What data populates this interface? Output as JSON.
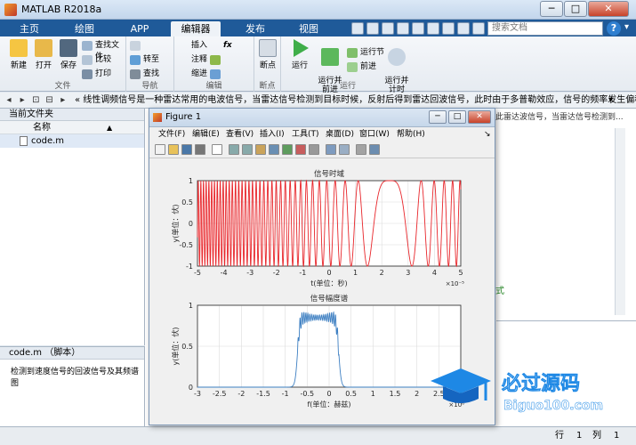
{
  "window": {
    "title": "MATLAB R2018a",
    "min": "─",
    "max": "□",
    "close": "✕"
  },
  "tabs": [
    "主页",
    "绘图",
    "APP",
    "编辑器",
    "发布",
    "视图"
  ],
  "active_tab": "编辑器",
  "search": {
    "placeholder": "搜索文档"
  },
  "ribbon": {
    "file": {
      "label": "文件",
      "new": "新建",
      "open": "打开",
      "save": "保存",
      "find_file": "查找文件",
      "compare": "比较",
      "print": "打印"
    },
    "nav": {
      "label": "导航",
      "goto": "转至",
      "find": "查找"
    },
    "edit": {
      "label": "编辑",
      "insert": "插入",
      "comment": "注释",
      "indent": "缩进",
      "fx": "fx"
    },
    "breakpoint": {
      "label": "断点",
      "breakpoints": "断点"
    },
    "run": {
      "label": "运行",
      "run": "运行",
      "run_advance": "运行并\n前进",
      "run_section": "运行节",
      "advance": "前进",
      "run_time": "运行并\n计时"
    }
  },
  "address_bar": {
    "nav_symbols": [
      "◂",
      "▸",
      "⊡",
      "⊟",
      "▸"
    ],
    "path": "«  线性调频信号是一种雷达常用的电波信号，当雷达信号检测到目标时候，反射后得到雷达回波信号，此时由于多普勒效应，信号的频率发生偏移，这个源...",
    "dropdown": "▾"
  },
  "left_panel": {
    "title": "当前文件夹",
    "name_col": "名称",
    "sort": "▲",
    "files": [
      "code.m"
    ]
  },
  "detail_panel": {
    "title": "code.m （脚本）",
    "description": "检测到速度信号的回波信号及其频谱图"
  },
  "editor_behind": {
    "snippet": "此雷达波信号，当雷达信号检测到...",
    "expr_text": "达式"
  },
  "status_bar": {
    "row_label": "行",
    "row": "1",
    "col_label": "列",
    "col": "1"
  },
  "figure": {
    "title": "Figure 1",
    "menus": [
      "文件(F)",
      "编辑(E)",
      "查看(V)",
      "插入(I)",
      "工具(T)",
      "桌面(D)",
      "窗口(W)",
      "帮助(H)"
    ],
    "menu_arrow": "↘",
    "toolbar_icons": [
      "new-figure-icon",
      "open-icon",
      "save-icon",
      "print-icon",
      "pointer-icon",
      "zoom-in-icon",
      "zoom-out-icon",
      "pan-icon",
      "rotate-icon",
      "datatip-icon",
      "brush-icon",
      "link-icon",
      "colorbar-icon",
      "legend-icon",
      "hide-plot-tools-icon",
      "show-plot-tools-icon"
    ]
  },
  "chart_data": [
    {
      "type": "line",
      "title": "信号时域",
      "xlabel": "t(单位：秒)",
      "ylabel": "y(单位：伏)",
      "xlim": [
        -5,
        5
      ],
      "ylim": [
        -1,
        1
      ],
      "x_ticks": [
        "-5",
        "-4",
        "-3",
        "-2",
        "-1",
        "0",
        "1",
        "2",
        "3",
        "4",
        "5"
      ],
      "y_ticks": [
        "-1",
        "-0.5",
        "0",
        "0.5",
        "1"
      ],
      "x_exponent": "×10⁻⁵",
      "grid": true,
      "color": "#e8262b",
      "description_of_signal": "",
      "vertex_t": 2.3,
      "chirp_k": 0.7
    },
    {
      "type": "line",
      "title": "信号幅度谱",
      "xlabel": "f(单位：赫兹)",
      "ylabel": "y(单位：伏)",
      "xlim": [
        -3,
        3
      ],
      "ylim": [
        0,
        1
      ],
      "x_ticks": [
        "-3",
        "-2.5",
        "-2",
        "-1.5",
        "-1",
        "-0.5",
        "0",
        "0.5",
        "1",
        "1.5",
        "2",
        "2.5",
        "3"
      ],
      "y_ticks": [
        "0",
        "0.5",
        "1"
      ],
      "x_exponent": "×10⁶",
      "grid": true,
      "color": "#3d7fc2",
      "band": [
        -0.72,
        0.22
      ],
      "peak_level": 0.85
    }
  ],
  "watermark": {
    "brand": "必过源码",
    "url": "Biguo100.com"
  },
  "colors": {
    "ribbon_blue": "#1f5a99",
    "signal_red": "#e8262b",
    "spectrum_blue": "#3d7fc2"
  }
}
